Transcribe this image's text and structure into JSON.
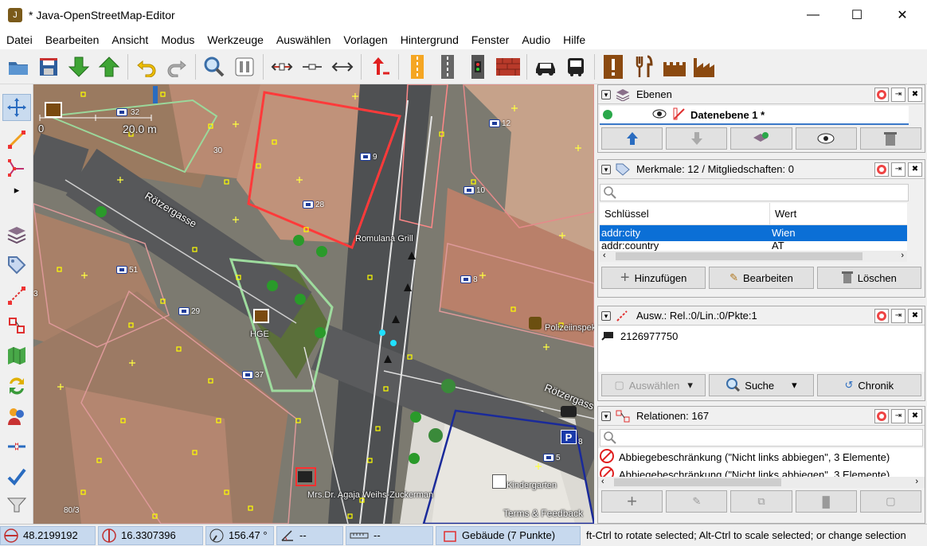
{
  "window": {
    "title": "* Java-OpenStreetMap-Editor",
    "app_icon": "josm-icon"
  },
  "menu": [
    "Datei",
    "Bearbeiten",
    "Ansicht",
    "Modus",
    "Werkzeuge",
    "Auswählen",
    "Vorlagen",
    "Hintergrund",
    "Fenster",
    "Audio",
    "Hilfe"
  ],
  "toolbar_icons": [
    "open-file-icon",
    "save-icon",
    "download-icon",
    "upload-icon",
    "undo-icon",
    "redo-icon",
    "zoom-icon",
    "preferences-icon",
    "split-way-icon",
    "combine-way-icon",
    "reverse-way-icon",
    "move-up-icon",
    "crossing-icon",
    "road-icon",
    "traffic-signals-icon",
    "wall-icon",
    "car-icon",
    "bus-icon",
    "warning-icon",
    "restaurant-icon",
    "castle-icon",
    "factory-icon"
  ],
  "map": {
    "scale_label": "20.0 m",
    "scale_zero": "0",
    "streets": [
      "Rötzergasse",
      "Rötzergass"
    ],
    "labels": [
      "Romulana Grill",
      "HGE",
      "Polizeiinspek",
      "Kindergarten",
      "Mrs.Dr. Agaja Weihs-Zuckerman"
    ],
    "house_numbers": [
      "30",
      "9",
      "28",
      "12",
      "10",
      "51",
      "8",
      "29",
      "37",
      "3",
      "80/3",
      "5",
      "8"
    ],
    "terms": "Terms & Feedback",
    "colors": {
      "building": "#ff3030",
      "selection": "#ffff00",
      "landuse": "#88dd88"
    }
  },
  "layers": {
    "title": "Ebenen",
    "layer_name": "Datenebene 1 *"
  },
  "tags": {
    "title": "Merkmale: 12 / Mitgliedschaften: 0",
    "col_key": "Schlüssel",
    "col_value": "Wert",
    "rows": [
      {
        "key": "addr:city",
        "value": "Wien",
        "selected": true
      },
      {
        "key": "addr:country",
        "value": "AT",
        "selected": false
      }
    ],
    "btn_add": "Hinzufügen",
    "btn_edit": "Bearbeiten",
    "btn_delete": "Löschen"
  },
  "selection": {
    "title": "Ausw.: Rel.:0/Lin.:0/Pkte:1",
    "item": "2126977750",
    "btn_select": "Auswählen",
    "btn_search": "Suche",
    "btn_history": "Chronik"
  },
  "relations": {
    "title": "Relationen: 167",
    "items": [
      "Abbiegebeschränkung (\"Nicht links abbiegen\", 3 Elemente)",
      "Abbiegebeschränkung (\"Nicht links abbiegen\", 3 Elemente)"
    ]
  },
  "status": {
    "lat": "48.2199192",
    "lon": "16.3307396",
    "heading": "156.47 °",
    "angle": "--",
    "length": "--",
    "object": "Gebäude (7 Punkte)",
    "help": "ft-Ctrl to rotate selected; Alt-Ctrl to scale selected; or change selection"
  }
}
